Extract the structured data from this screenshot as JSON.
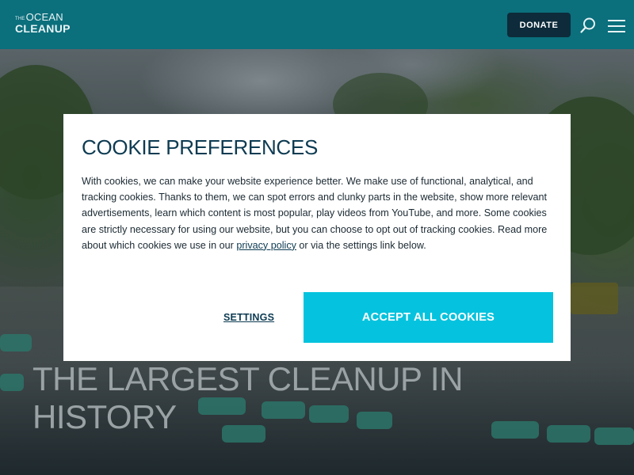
{
  "header": {
    "logo_the": "THE",
    "logo_ocean": "OCEAN",
    "logo_cleanup": "CLEANUP",
    "donate_label": "DONATE",
    "search_icon": "search-icon",
    "menu_icon": "hamburger-menu-icon",
    "bg_color": "#0b6f7c"
  },
  "hero": {
    "title_line1": "THE LARGEST CLEANUP IN",
    "title_line2": "HISTORY"
  },
  "cookie_modal": {
    "title": "COOKIE PREFERENCES",
    "body_text": "With cookies, we can make your website experience better. We make use of functional, analytical, and tracking cookies. Thanks to them, we can spot errors and clunky parts in the website, show more relevant advertisements, learn which content is most popular, play videos from YouTube, and more. Some cookies are strictly necessary for using our website, but you can choose to opt out of tracking cookies. Read more about which cookies we use in our ",
    "privacy_link": "privacy policy",
    "body_text_end": " or via the settings link below.",
    "settings_label": "SETTINGS",
    "accept_label": "ACCEPT ALL COOKIES",
    "accent_color": "#05c3de"
  }
}
